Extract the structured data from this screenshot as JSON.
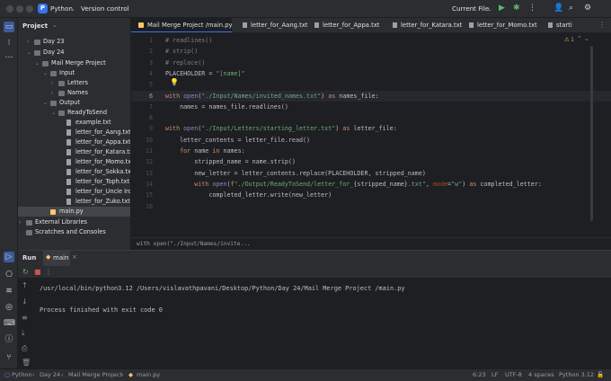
{
  "titlebar": {
    "project_badge": "P",
    "project_name": "Python",
    "vcs_label": "Version control",
    "run_config": "Current File"
  },
  "project_panel": {
    "title": "Project",
    "tree": [
      {
        "label": "Day 23",
        "kind": "folder",
        "depth": 1,
        "arrow": "›"
      },
      {
        "label": "Day 24",
        "kind": "folder",
        "depth": 1,
        "arrow": "⌄"
      },
      {
        "label": "Mail Merge Project",
        "kind": "folder",
        "depth": 2,
        "arrow": "⌄"
      },
      {
        "label": "Input",
        "kind": "folder",
        "depth": 3,
        "arrow": "⌄"
      },
      {
        "label": "Letters",
        "kind": "folder",
        "depth": 4,
        "arrow": "›"
      },
      {
        "label": "Names",
        "kind": "folder",
        "depth": 4,
        "arrow": "›"
      },
      {
        "label": "Output",
        "kind": "folder",
        "depth": 3,
        "arrow": "⌄"
      },
      {
        "label": "ReadyToSend",
        "kind": "folder",
        "depth": 4,
        "arrow": "⌄"
      },
      {
        "label": "example.txt",
        "kind": "file",
        "depth": 5,
        "arrow": ""
      },
      {
        "label": "letter_for_Aang.txt",
        "kind": "file",
        "depth": 5,
        "arrow": ""
      },
      {
        "label": "letter_for_Appa.txt",
        "kind": "file",
        "depth": 5,
        "arrow": ""
      },
      {
        "label": "letter_for_Katara.txt",
        "kind": "file",
        "depth": 5,
        "arrow": ""
      },
      {
        "label": "letter_for_Momo.txt",
        "kind": "file",
        "depth": 5,
        "arrow": ""
      },
      {
        "label": "letter_for_Sokka.txt",
        "kind": "file",
        "depth": 5,
        "arrow": ""
      },
      {
        "label": "letter_for_Toph.txt",
        "kind": "file",
        "depth": 5,
        "arrow": ""
      },
      {
        "label": "letter_for_Uncle Iroh.txt",
        "kind": "file",
        "depth": 5,
        "arrow": ""
      },
      {
        "label": "letter_for_Zuko.txt",
        "kind": "file",
        "depth": 5,
        "arrow": ""
      },
      {
        "label": "main.py",
        "kind": "py",
        "depth": 3,
        "arrow": "",
        "selected": true
      },
      {
        "label": "External Libraries",
        "kind": "folder",
        "depth": 0,
        "arrow": "›"
      },
      {
        "label": "Scratches and Consoles",
        "kind": "folder",
        "depth": 0,
        "arrow": ""
      }
    ]
  },
  "tabs": [
    {
      "label": "Mail Merge Project /main.py",
      "active": true,
      "kind": "py"
    },
    {
      "label": "letter_for_Aang.txt",
      "active": false,
      "kind": "file"
    },
    {
      "label": "letter_for_Appa.txt",
      "active": false,
      "kind": "file"
    },
    {
      "label": "letter_for_Katara.txt",
      "active": false,
      "kind": "file"
    },
    {
      "label": "letter_for_Momo.txt",
      "active": false,
      "kind": "file"
    },
    {
      "label": "starti",
      "active": false,
      "kind": "file"
    }
  ],
  "editor": {
    "inspection_count": "1",
    "lines": [
      {
        "n": "1",
        "html": "<span class='cm'># readlines()</span>"
      },
      {
        "n": "2",
        "html": "<span class='cm'># strip()</span>"
      },
      {
        "n": "3",
        "html": "<span class='cm'># replace()</span>"
      },
      {
        "n": "4",
        "html": "PLACEHOLDER = <span class='st'>\"[name]\"</span>"
      },
      {
        "n": "5",
        "html": ""
      },
      {
        "n": "6",
        "html": "<span class='kw'>with</span> <span class='bi'>open</span>(<span class='st'>\"./Input/Names/invited_names.txt\"</span>) <span class='kw'>as</span> names_file:",
        "current": true
      },
      {
        "n": "7",
        "html": "    names = names_file.readlines()"
      },
      {
        "n": "8",
        "html": ""
      },
      {
        "n": "9",
        "html": "<span class='kw'>with</span> <span class='bi'>open</span>(<span class='st'>\"./Input/Letters/starting_letter.txt\"</span>) <span class='kw'>as</span> letter_file:"
      },
      {
        "n": "10",
        "html": "    letter_contents = letter_file.read()"
      },
      {
        "n": "11",
        "html": "    <span class='kw'>for</span> name <span class='kw'>in</span> names:"
      },
      {
        "n": "12",
        "html": "        stripped_name = name.strip()"
      },
      {
        "n": "13",
        "html": "        new_letter = letter_contents.replace(PLACEHOLDER, stripped_name)"
      },
      {
        "n": "14",
        "html": "        <span class='kw'>with</span> <span class='bi'>open</span>(<span class='kw'>f</span><span class='st'>\"./Output/ReadyToSend/letter_for_</span>{stripped_name}<span class='st'>.txt\"</span>, <span class='kv'>mode</span>=<span class='st'>\"w\"</span>) <span class='kw'>as</span> completed_letter:"
      },
      {
        "n": "15",
        "html": "            completed_letter.write(new_letter)"
      },
      {
        "n": "16",
        "html": ""
      }
    ],
    "breadcrumb": "with open(\"./Input/Names/invite..."
  },
  "run_panel": {
    "tab_label": "Run",
    "config_label": "main",
    "command": "/usr/local/bin/python3.12 /Users/vislavathpavani/Desktop/Python/Day 24/Mail Merge Project /main.py",
    "result": "Process finished with exit code 0"
  },
  "statusbar": {
    "crumbs": [
      "Python",
      "Day 24",
      "Mail Merge Project",
      "main.py"
    ],
    "position": "6:23",
    "line_sep": "LF",
    "encoding": "UTF-8",
    "indent": "4 spaces",
    "interpreter": "Python 3.12"
  }
}
